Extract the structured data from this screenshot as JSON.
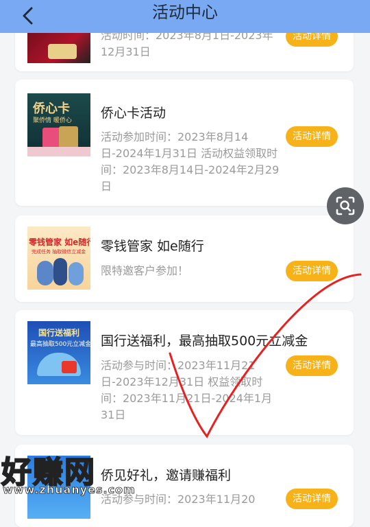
{
  "header": {
    "title": "活动中心"
  },
  "cards": [
    {
      "title": "",
      "desc": "活动时间：2023年8月1日-2023年12月31日",
      "button": "活动详情"
    },
    {
      "title": "侨心卡活动",
      "desc": "活动参加时间：2023年8月14日-2024年1月31日 活动权益领取时间：2023年8月14日-2024年2月29日",
      "button": "活动详情",
      "thumb_text": "侨心卡",
      "thumb_sub": "聚侨情 暖侨心"
    },
    {
      "title": "零钱管家 如e随行",
      "desc": "限特邀客户参加！",
      "button": "活动详情",
      "thumb_text": "零钱管家 如e随行",
      "thumb_sub": "完成任务 抽取微信立减金"
    },
    {
      "title": "国行送福利，最高抽取500元立减金",
      "desc": "活动参与时间：2023年11月21日-2023年12月31日 权益领取时间：2023年11月21日-2024年1月31日",
      "button": "活动详情",
      "thumb_text": "国行送福利",
      "thumb_sub": "最高抽取500元立减金"
    },
    {
      "title": "侨见好礼，邀请赚福利",
      "desc": "活动参与时间：2023年11月20",
      "button": "活动详情"
    }
  ],
  "watermark": {
    "main": "好赚网",
    "url": "www.zhuanyes.com"
  },
  "colors": {
    "header": "#79a9f2",
    "button": "#f7b21a",
    "check_mark": "#e8201f"
  }
}
